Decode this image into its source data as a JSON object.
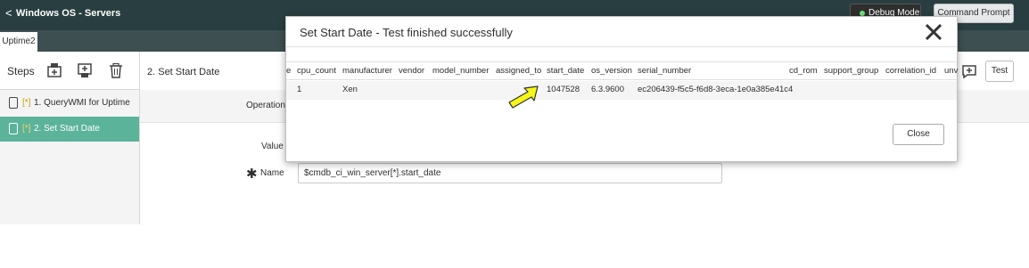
{
  "header": {
    "back_glyph": "<",
    "title": "Windows OS - Servers",
    "debug_label": "Debug Mode",
    "command_prompt_label": "Command Prompt"
  },
  "tabs": [
    "Uptime2"
  ],
  "steps_panel": {
    "label": "Steps",
    "items": [
      {
        "mark": "[*]",
        "number": "1.",
        "label": "QueryWMI for Uptime"
      },
      {
        "mark": "[*]",
        "number": "2.",
        "label": "Set Start Date"
      }
    ]
  },
  "main": {
    "title": "2. Set Start Date",
    "operation_label": "Operation",
    "value_label": "Value",
    "name_label": "Name",
    "name_value": "$cmdb_ci_win_server[*].start_date",
    "test_label": "Test"
  },
  "modal": {
    "title": "Set Start Date - Test finished successfully",
    "columns": [
      "e",
      "cpu_count",
      "manufacturer",
      "vendor",
      "model_number",
      "assigned_to",
      "start_date",
      "os_version",
      "serial_number",
      "cd_rom",
      "support_group",
      "correlation_id",
      "unv"
    ],
    "row": [
      "",
      "1",
      "Xen",
      "",
      "",
      "",
      "1047528",
      "6.3.9600",
      "ec206439-f5c5-f6d8-3eca-1e0a385e41c4",
      "",
      "",
      "",
      ""
    ],
    "close_label": "Close"
  },
  "colors": {
    "header": "#293e40",
    "active_step": "#5bb39a",
    "debug_dot": "#71e279",
    "arrow": "#f5f51a"
  }
}
